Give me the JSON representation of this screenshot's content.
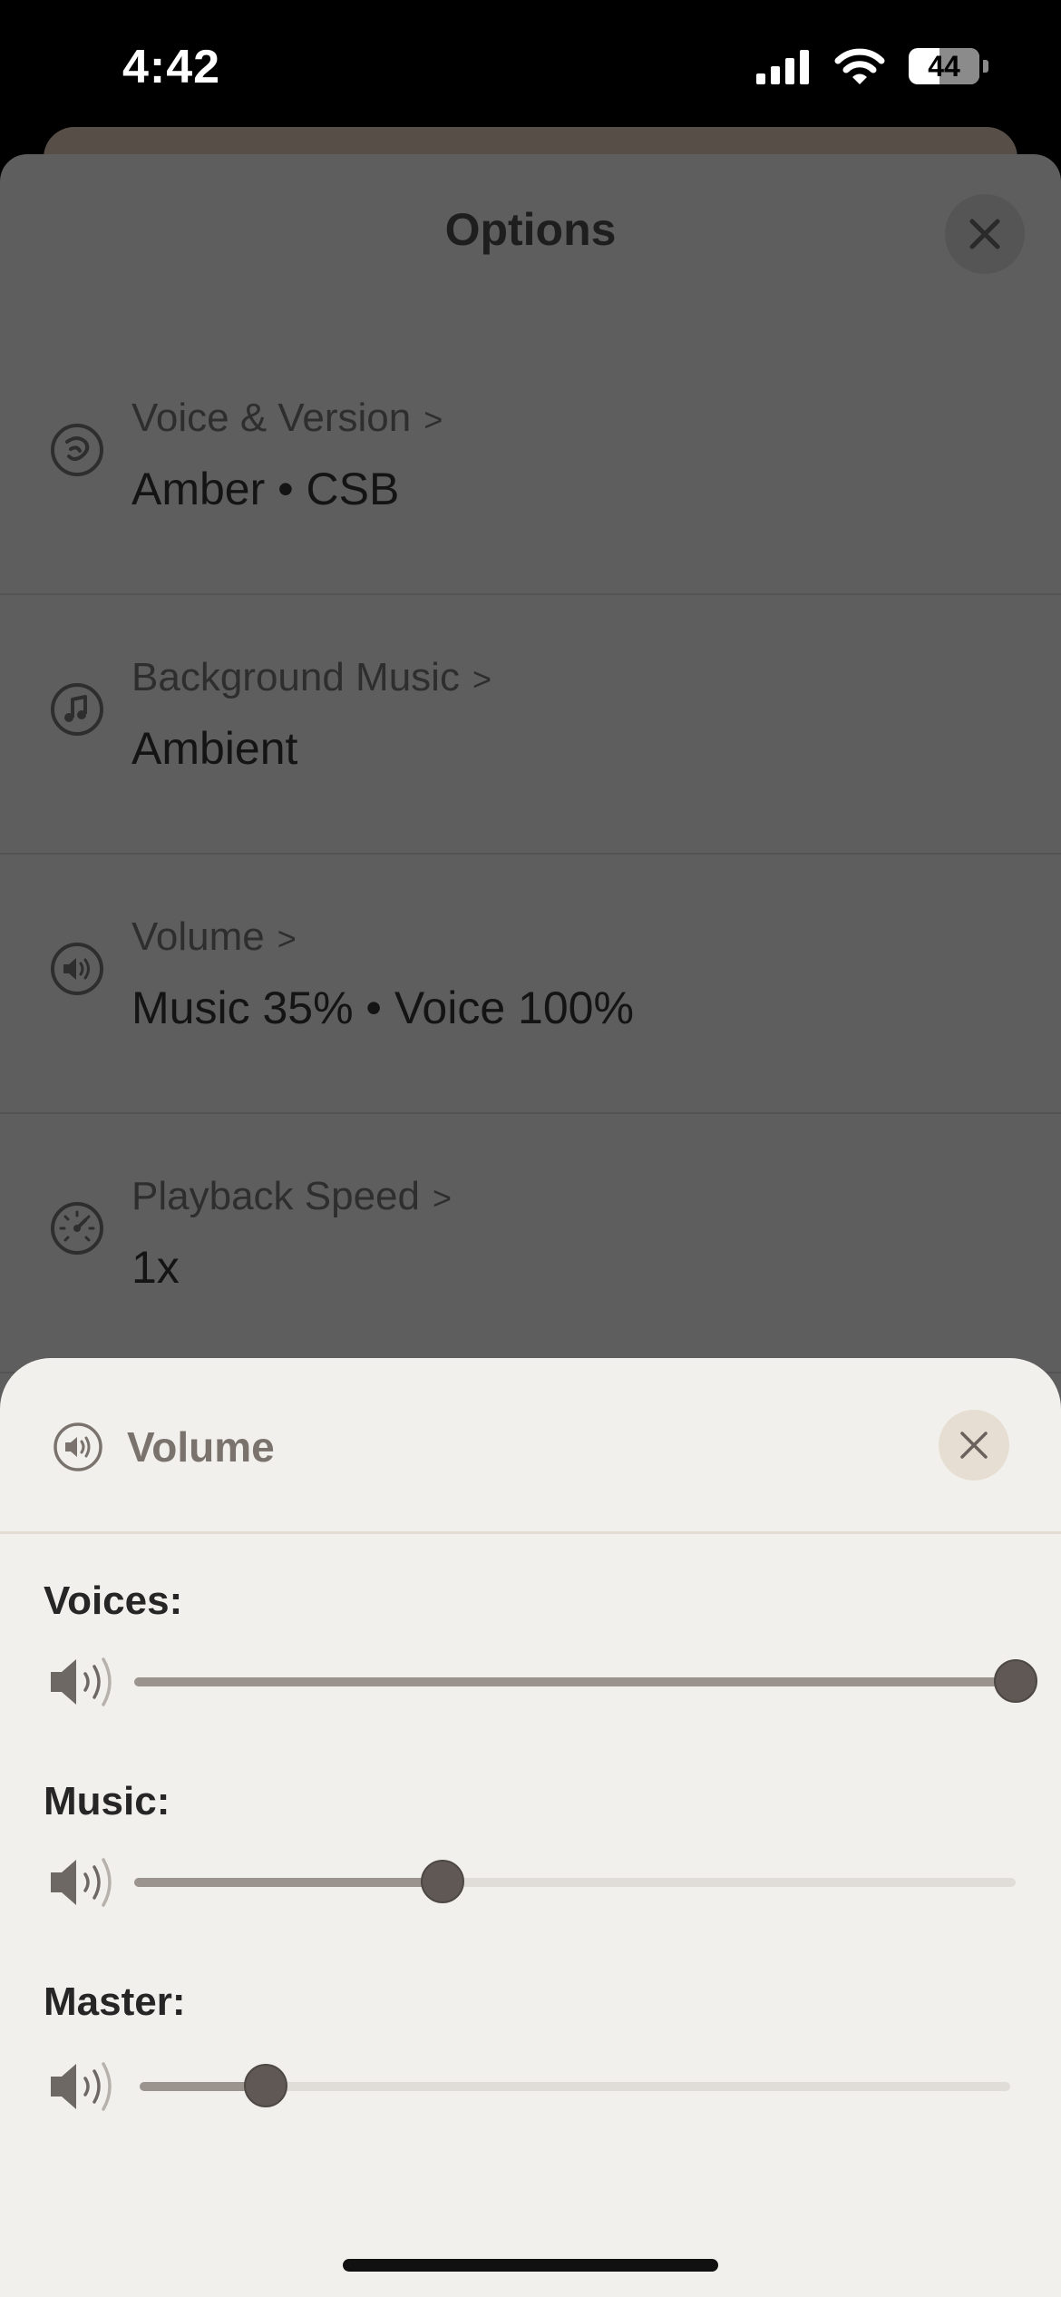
{
  "status": {
    "time": "4:42",
    "battery_level": "44",
    "battery_fraction": 0.44
  },
  "options": {
    "title": "Options",
    "rows": [
      {
        "label": "Voice & Version",
        "value": "Amber • CSB",
        "icon": "voice-icon"
      },
      {
        "label": "Background Music",
        "value": "Ambient",
        "icon": "music-note-icon"
      },
      {
        "label": "Volume",
        "value": "Music 35% • Voice 100%",
        "icon": "speaker-icon"
      },
      {
        "label": "Playback Speed",
        "value": "1x",
        "icon": "speedometer-icon"
      }
    ],
    "chevron": ">"
  },
  "volume": {
    "title": "Volume",
    "sliders": [
      {
        "label": "Voices:",
        "fraction": 1.0
      },
      {
        "label": "Music:",
        "fraction": 0.35
      },
      {
        "label": "Master:",
        "fraction": 0.145
      }
    ]
  },
  "colors": {
    "sheet_bg": "#f2f0ec",
    "dim_bg": "#5e5e5e",
    "slider_fill": "#9a938e",
    "slider_thumb": "#5f5854",
    "accent_text": "#7a726c"
  }
}
